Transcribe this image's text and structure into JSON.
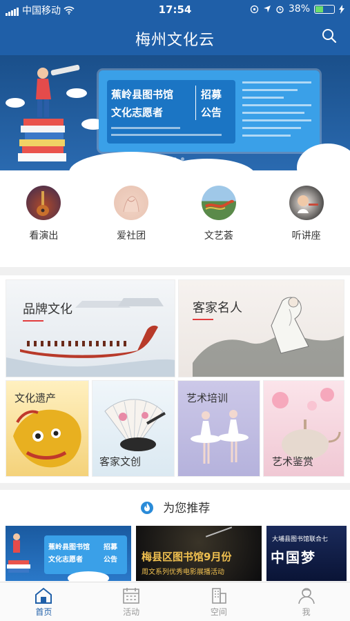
{
  "status": {
    "carrier": "中国移动",
    "time": "17:54",
    "battery": "38%"
  },
  "header": {
    "title": "梅州文化云"
  },
  "banner": {
    "line1": "蕉岭县图书馆",
    "line1b": "招募",
    "line2": "文化志愿者",
    "line2b": "公告",
    "slides": 3,
    "active_slide": 1
  },
  "categories": [
    {
      "label": "看演出",
      "icon": "guitar-icon"
    },
    {
      "label": "爱社团",
      "icon": "hands-icon"
    },
    {
      "label": "文艺荟",
      "icon": "dragon-icon"
    },
    {
      "label": "听讲座",
      "icon": "lecture-icon"
    }
  ],
  "tiles": {
    "brand": "品牌文化",
    "people": "客家名人",
    "heritage": "文化遗产",
    "creative": "客家文创",
    "training": "艺术培训",
    "appreciation": "艺术鉴赏"
  },
  "recommend": {
    "title": "为您推荐",
    "items": [
      {
        "line1": "蕉岭县图书馆",
        "line1b": "招募",
        "line2": "文化志愿者",
        "line2b": "公告"
      },
      {
        "line1": "梅县区图书馆9月份",
        "line2": "周文系列优秀电影展播活动"
      },
      {
        "line1": "大埔县图书馆联合七",
        "line2": "中国梦"
      }
    ]
  },
  "tabs": [
    {
      "label": "首页",
      "icon": "home-icon",
      "active": true
    },
    {
      "label": "活动",
      "icon": "calendar-icon",
      "active": false
    },
    {
      "label": "空间",
      "icon": "building-icon",
      "active": false
    },
    {
      "label": "我",
      "icon": "user-icon",
      "active": false
    }
  ],
  "colors": {
    "brand": "#1f5fa8",
    "accent": "#e23c3c"
  }
}
